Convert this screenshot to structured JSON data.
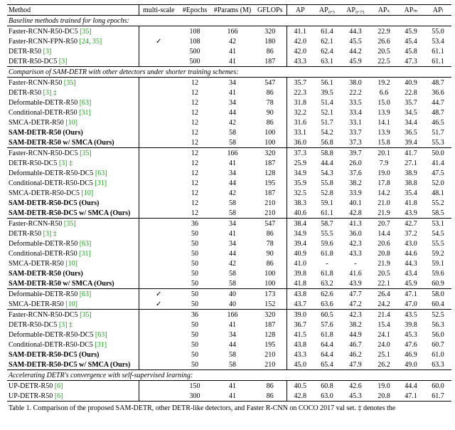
{
  "columns": {
    "method": "Method",
    "multiscale": "multi-scale",
    "epochs": "#Epochs",
    "params": "#Params (M)",
    "gflops": "GFLOPs",
    "ap": "AP",
    "ap50": "AP₀.₅",
    "ap75": "AP₀.₇₅",
    "aps": "APₛ",
    "apm": "APₘ",
    "apl": "APₗ"
  },
  "sections": {
    "s0": "Baseline methods trained for long epochs:",
    "s1": "Comparison of SAM-DETR with other detectors under shorter training schemes:",
    "s2": "Accelerating DETR's convergence with self-supervised learning:"
  },
  "rows": [
    {
      "m": "Faster-RCNN-R50-DC5",
      "r": "[35]",
      "b": false,
      "ms": false,
      "e": "108",
      "p": "166",
      "g": "320",
      "a": "41.1",
      "a5": "61.4",
      "a7": "44.3",
      "as": "22.9",
      "am": "45.9",
      "al": "55.0"
    },
    {
      "m": "Faster-RCNN-FPN-R50",
      "r": "[24, 35]",
      "b": false,
      "ms": true,
      "e": "108",
      "p": "42",
      "g": "180",
      "a": "42.0",
      "a5": "62.1",
      "a7": "45.5",
      "as": "26.6",
      "am": "45.4",
      "al": "53.4"
    },
    {
      "m": "DETR-R50",
      "r": "[3]",
      "b": false,
      "ms": false,
      "e": "500",
      "p": "41",
      "g": "86",
      "a": "42.0",
      "a5": "62.4",
      "a7": "44.2",
      "as": "20.5",
      "am": "45.8",
      "al": "61.1"
    },
    {
      "m": "DETR-R50-DC5",
      "r": "[3]",
      "b": false,
      "ms": false,
      "e": "500",
      "p": "41",
      "g": "187",
      "a": "43.3",
      "a5": "63.1",
      "a7": "45.9",
      "as": "22.5",
      "am": "47.3",
      "al": "61.1"
    },
    {
      "m": "Faster-RCNN-R50",
      "r": "[35]",
      "b": false,
      "ms": false,
      "e": "12",
      "p": "34",
      "g": "547",
      "a": "35.7",
      "a5": "56.1",
      "a7": "38.0",
      "as": "19.2",
      "am": "40.9",
      "al": "48.7"
    },
    {
      "m": "DETR-R50",
      "r": "[3] ‡",
      "b": false,
      "ms": false,
      "e": "12",
      "p": "41",
      "g": "86",
      "a": "22.3",
      "a5": "39.5",
      "a7": "22.2",
      "as": "6.6",
      "am": "22.8",
      "al": "36.6"
    },
    {
      "m": "Deformable-DETR-R50",
      "r": "[63]",
      "b": false,
      "ms": false,
      "e": "12",
      "p": "34",
      "g": "78",
      "a": "31.8",
      "a5": "51.4",
      "a7": "33.5",
      "as": "15.0",
      "am": "35.7",
      "al": "44.7"
    },
    {
      "m": "Conditional-DETR-R50",
      "r": "[31]",
      "b": false,
      "ms": false,
      "e": "12",
      "p": "44",
      "g": "90",
      "a": "32.2",
      "a5": "52.1",
      "a7": "33.4",
      "as": "13.9",
      "am": "34.5",
      "al": "48.7"
    },
    {
      "m": "SMCA-DETR-R50",
      "r": "[10]",
      "b": false,
      "ms": false,
      "e": "12",
      "p": "42",
      "g": "86",
      "a": "31.6",
      "a5": "51.7",
      "a7": "33.1",
      "as": "14.1",
      "am": "34.4",
      "al": "46.5"
    },
    {
      "m": "SAM-DETR-R50 (Ours)",
      "r": "",
      "b": true,
      "ms": false,
      "e": "12",
      "p": "58",
      "g": "100",
      "a": "33.1",
      "a5": "54.2",
      "a7": "33.7",
      "as": "13.9",
      "am": "36.5",
      "al": "51.7"
    },
    {
      "m": "SAM-DETR-R50 w/ SMCA (Ours)",
      "r": "",
      "b": true,
      "ms": false,
      "e": "12",
      "p": "58",
      "g": "100",
      "a": "36.0",
      "a5": "56.8",
      "a7": "37.3",
      "as": "15.8",
      "am": "39.4",
      "al": "55.3"
    },
    {
      "m": "Faster-RCNN-R50-DC5",
      "r": "[35]",
      "b": false,
      "ms": false,
      "e": "12",
      "p": "166",
      "g": "320",
      "a": "37.3",
      "a5": "58.8",
      "a7": "39.7",
      "as": "20.1",
      "am": "41.7",
      "al": "50.0"
    },
    {
      "m": "DETR-R50-DC5",
      "r": "[3] ‡",
      "b": false,
      "ms": false,
      "e": "12",
      "p": "41",
      "g": "187",
      "a": "25.9",
      "a5": "44.4",
      "a7": "26.0",
      "as": "7.9",
      "am": "27.1",
      "al": "41.4"
    },
    {
      "m": "Deformable-DETR-R50-DC5",
      "r": "[63]",
      "b": false,
      "ms": false,
      "e": "12",
      "p": "34",
      "g": "128",
      "a": "34.9",
      "a5": "54.3",
      "a7": "37.6",
      "as": "19.0",
      "am": "38.9",
      "al": "47.5"
    },
    {
      "m": "Conditional-DETR-R50-DC5",
      "r": "[31]",
      "b": false,
      "ms": false,
      "e": "12",
      "p": "44",
      "g": "195",
      "a": "35.9",
      "a5": "55.8",
      "a7": "38.2",
      "as": "17.8",
      "am": "38.8",
      "al": "52.0"
    },
    {
      "m": "SMCA-DETR-R50-DC5",
      "r": "[10]",
      "b": false,
      "ms": false,
      "e": "12",
      "p": "42",
      "g": "187",
      "a": "32.5",
      "a5": "52.8",
      "a7": "33.9",
      "as": "14.2",
      "am": "35.4",
      "al": "48.1"
    },
    {
      "m": "SAM-DETR-R50-DC5 (Ours)",
      "r": "",
      "b": true,
      "ms": false,
      "e": "12",
      "p": "58",
      "g": "210",
      "a": "38.3",
      "a5": "59.1",
      "a7": "40.1",
      "as": "21.0",
      "am": "41.8",
      "al": "55.2"
    },
    {
      "m": "SAM-DETR-R50-DC5 w/ SMCA (Ours)",
      "r": "",
      "b": true,
      "ms": false,
      "e": "12",
      "p": "58",
      "g": "210",
      "a": "40.6",
      "a5": "61.1",
      "a7": "42.8",
      "as": "21.9",
      "am": "43.9",
      "al": "58.5"
    },
    {
      "m": "Faster-RCNN-R50",
      "r": "[35]",
      "b": false,
      "ms": false,
      "e": "36",
      "p": "34",
      "g": "547",
      "a": "38.4",
      "a5": "58.7",
      "a7": "41.3",
      "as": "20.7",
      "am": "42.7",
      "al": "53.1"
    },
    {
      "m": "DETR-R50",
      "r": "[3] ‡",
      "b": false,
      "ms": false,
      "e": "50",
      "p": "41",
      "g": "86",
      "a": "34.9",
      "a5": "55.5",
      "a7": "36.0",
      "as": "14.4",
      "am": "37.2",
      "al": "54.5"
    },
    {
      "m": "Deformable-DETR-R50",
      "r": "[63]",
      "b": false,
      "ms": false,
      "e": "50",
      "p": "34",
      "g": "78",
      "a": "39.4",
      "a5": "59.6",
      "a7": "42.3",
      "as": "20.6",
      "am": "43.0",
      "al": "55.5"
    },
    {
      "m": "Conditional-DETR-R50",
      "r": "[31]",
      "b": false,
      "ms": false,
      "e": "50",
      "p": "44",
      "g": "90",
      "a": "40.9",
      "a5": "61.8",
      "a7": "43.3",
      "as": "20.8",
      "am": "44.6",
      "al": "59.2"
    },
    {
      "m": "SMCA-DETR-R50",
      "r": "[10]",
      "b": false,
      "ms": false,
      "e": "50",
      "p": "42",
      "g": "86",
      "a": "41.0",
      "a5": "-",
      "a7": "-",
      "as": "21.9",
      "am": "44.3",
      "al": "59.1"
    },
    {
      "m": "SAM-DETR-R50 (Ours)",
      "r": "",
      "b": true,
      "ms": false,
      "e": "50",
      "p": "58",
      "g": "100",
      "a": "39.8",
      "a5": "61.8",
      "a7": "41.6",
      "as": "20.5",
      "am": "43.4",
      "al": "59.6"
    },
    {
      "m": "SAM-DETR-R50 w/ SMCA (Ours)",
      "r": "",
      "b": true,
      "ms": false,
      "e": "50",
      "p": "58",
      "g": "100",
      "a": "41.8",
      "a5": "63.2",
      "a7": "43.9",
      "as": "22.1",
      "am": "45.9",
      "al": "60.9"
    },
    {
      "m": "Deformable-DETR-R50",
      "r": "[63]",
      "b": false,
      "ms": true,
      "e": "50",
      "p": "40",
      "g": "173",
      "a": "43.8",
      "a5": "62.6",
      "a7": "47.7",
      "as": "26.4",
      "am": "47.1",
      "al": "58.0"
    },
    {
      "m": "SMCA-DETR-R50",
      "r": "[10]",
      "b": false,
      "ms": true,
      "e": "50",
      "p": "40",
      "g": "152",
      "a": "43.7",
      "a5": "63.6",
      "a7": "47.2",
      "as": "24.2",
      "am": "47.0",
      "al": "60.4"
    },
    {
      "m": "Faster-RCNN-R50-DC5",
      "r": "[35]",
      "b": false,
      "ms": false,
      "e": "36",
      "p": "166",
      "g": "320",
      "a": "39.0",
      "a5": "60.5",
      "a7": "42.3",
      "as": "21.4",
      "am": "43.5",
      "al": "52.5"
    },
    {
      "m": "DETR-R50-DC5",
      "r": "[3] ‡",
      "b": false,
      "ms": false,
      "e": "50",
      "p": "41",
      "g": "187",
      "a": "36.7",
      "a5": "57.6",
      "a7": "38.2",
      "as": "15.4",
      "am": "39.8",
      "al": "56.3"
    },
    {
      "m": "Deformable-DETR-R50-DC5",
      "r": "[63]",
      "b": false,
      "ms": false,
      "e": "50",
      "p": "34",
      "g": "128",
      "a": "41.5",
      "a5": "61.8",
      "a7": "44.9",
      "as": "24.1",
      "am": "45.3",
      "al": "56.0"
    },
    {
      "m": "Conditional-DETR-R50-DC5",
      "r": "[31]",
      "b": false,
      "ms": false,
      "e": "50",
      "p": "44",
      "g": "195",
      "a": "43.8",
      "a5": "64.4",
      "a7": "46.7",
      "as": "24.0",
      "am": "47.6",
      "al": "60.7"
    },
    {
      "m": "SAM-DETR-R50-DC5 (Ours)",
      "r": "",
      "b": true,
      "ms": false,
      "e": "50",
      "p": "58",
      "g": "210",
      "a": "43.3",
      "a5": "64.4",
      "a7": "46.2",
      "as": "25.1",
      "am": "46.9",
      "al": "61.0"
    },
    {
      "m": "SAM-DETR-R50-DC5 w/ SMCA (Ours)",
      "r": "",
      "b": true,
      "ms": false,
      "e": "50",
      "p": "58",
      "g": "210",
      "a": "45.0",
      "a5": "65.4",
      "a7": "47.9",
      "as": "26.2",
      "am": "49.0",
      "al": "63.3"
    },
    {
      "m": "UP-DETR-R50",
      "r": "[6]",
      "b": false,
      "ms": false,
      "e": "150",
      "p": "41",
      "g": "86",
      "a": "40.5",
      "a5": "60.8",
      "a7": "42.6",
      "as": "19.0",
      "am": "44.4",
      "al": "60.0"
    },
    {
      "m": "UP-DETR-R50",
      "r": "[6]",
      "b": false,
      "ms": false,
      "e": "300",
      "p": "41",
      "g": "86",
      "a": "42.8",
      "a5": "63.0",
      "a7": "45.3",
      "as": "20.8",
      "am": "47.1",
      "al": "61.7"
    }
  ],
  "caption": "Table 1. Comparison of the proposed SAM-DETR, other DETR-like detectors, and Faster R-CNN on COCO 2017 val set. ‡ denotes the"
}
